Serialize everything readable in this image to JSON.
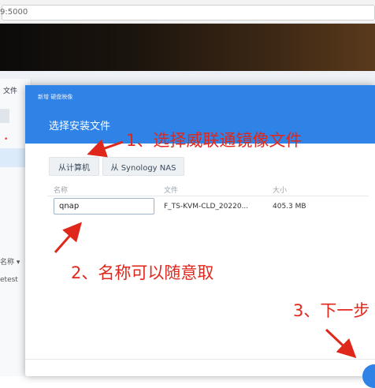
{
  "browser": {
    "url": "9:5000"
  },
  "background_app": {
    "file_label": "文件",
    "name_column": "名称 ▾",
    "row_text": "etest"
  },
  "modal": {
    "breadcrumb": "新增 硬盘映像",
    "title": "选择安装文件",
    "source_buttons": [
      "从计算机",
      "从 Synology NAS"
    ],
    "columns": [
      "名称",
      "文件",
      "大小"
    ],
    "row": {
      "name_value": "qnap",
      "file": "F_TS-KVM-CLD_20220...",
      "size": "405.3 MB"
    }
  },
  "annotations": {
    "step1": "1、选择威联通镜像文件",
    "step2": "2、名称可以随意取",
    "step3": "3、下一步"
  },
  "colors": {
    "accent": "#2f83e6",
    "annotation": "#e0271c"
  }
}
